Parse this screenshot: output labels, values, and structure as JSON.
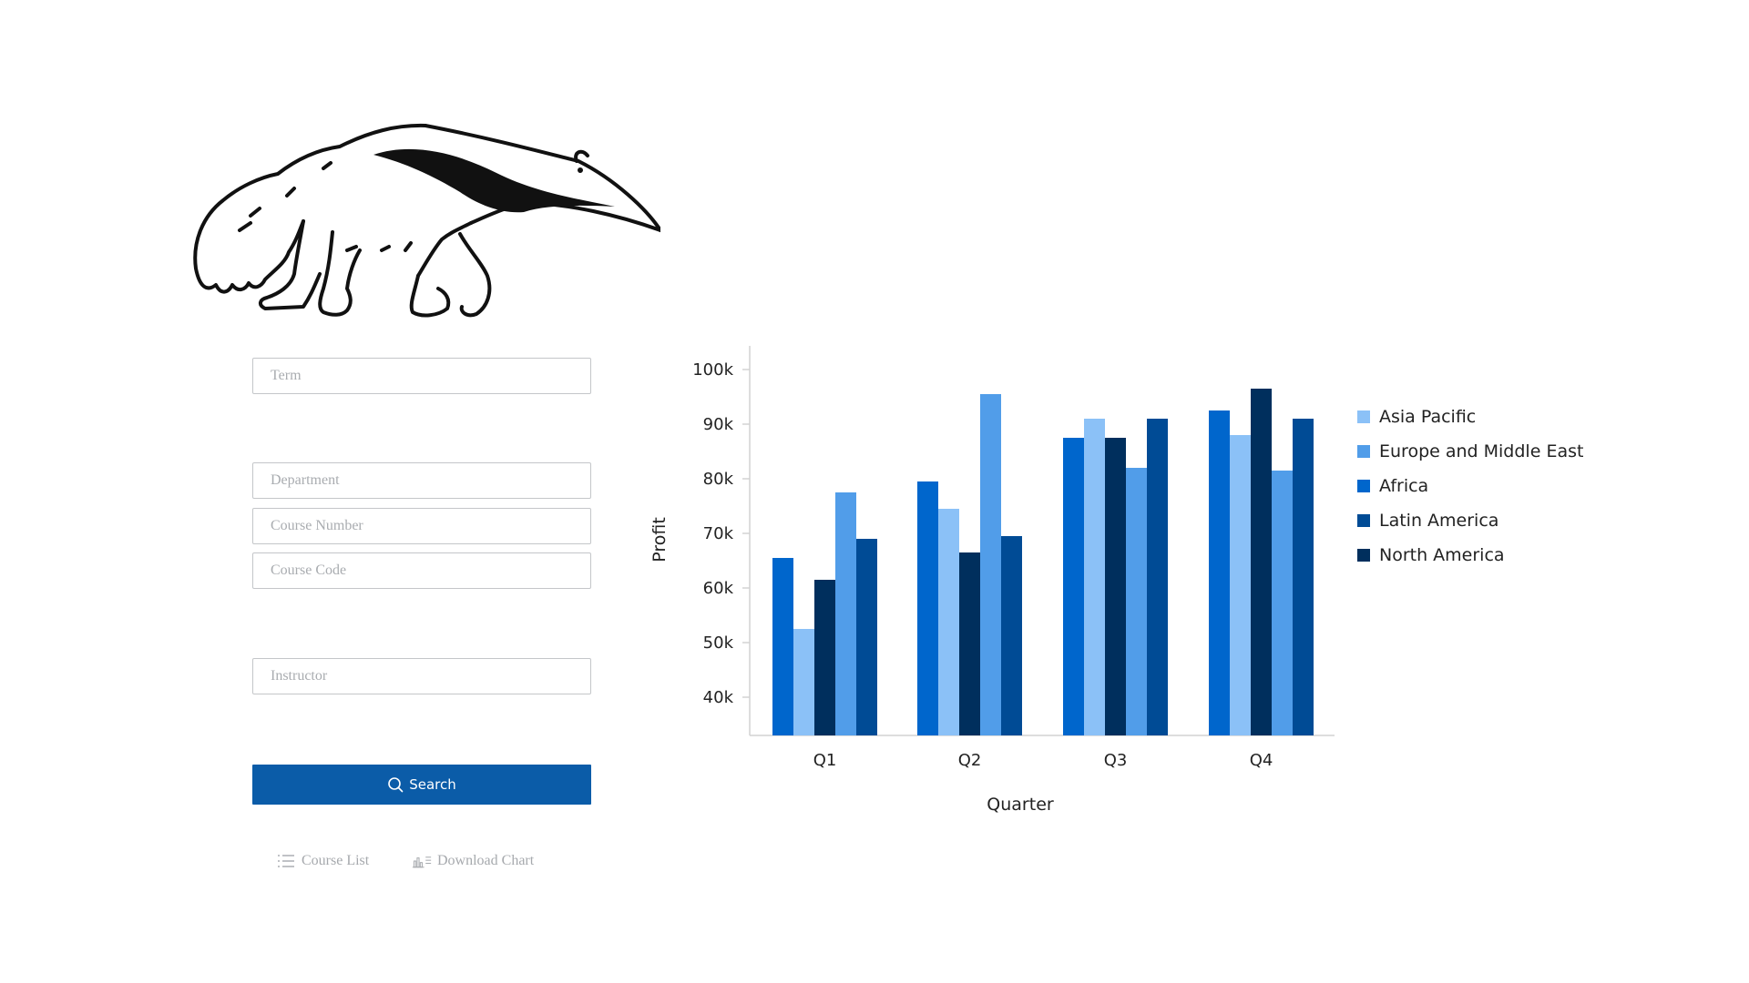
{
  "form": {
    "term_placeholder": "Term",
    "department_placeholder": "Department",
    "course_number_placeholder": "Course Number",
    "course_code_placeholder": "Course Code",
    "instructor_placeholder": "Instructor",
    "search_label": "Search",
    "search_icon": "search-icon"
  },
  "links": {
    "course_list_label": "Course List",
    "course_list_icon": "list-icon",
    "download_chart_label": "Download Chart",
    "download_chart_icon": "bar-chart-icon"
  },
  "mascot": {
    "icon": "anteater-illustration"
  },
  "chart_data": {
    "type": "bar",
    "title": "",
    "xlabel": "Quarter",
    "ylabel": "Profit",
    "categories": [
      "Q1",
      "Q2",
      "Q3",
      "Q4"
    ],
    "yticks": [
      "40k",
      "50k",
      "60k",
      "70k",
      "80k",
      "90k",
      "100k"
    ],
    "ylim": [
      33000,
      104000
    ],
    "grid": false,
    "legend_position": "right",
    "series": [
      {
        "name": "Africa",
        "color": "#0066cc",
        "values": [
          65500,
          79500,
          87500,
          92500
        ]
      },
      {
        "name": "Asia Pacific",
        "color": "#8bc1f7",
        "values": [
          52500,
          74500,
          91000,
          88000
        ]
      },
      {
        "name": "North America",
        "color": "#002f5d",
        "values": [
          61500,
          66500,
          87500,
          96500
        ]
      },
      {
        "name": "Europe and Middle East",
        "color": "#519de9",
        "values": [
          77500,
          95500,
          82000,
          81500
        ]
      },
      {
        "name": "Latin America",
        "color": "#004b95",
        "values": [
          69000,
          69500,
          91000,
          91000
        ]
      }
    ],
    "legend_order": [
      "Asia Pacific",
      "Europe and Middle East",
      "Africa",
      "Latin America",
      "North America"
    ]
  }
}
